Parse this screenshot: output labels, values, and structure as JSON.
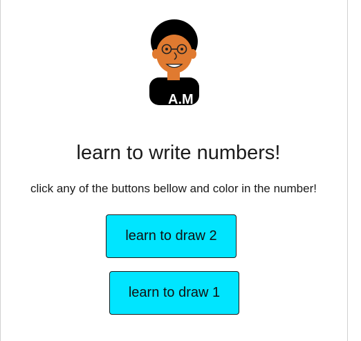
{
  "avatar": {
    "initials": "A.M",
    "skin_color": "#e07a30",
    "hair_color": "#000000"
  },
  "headline": "learn to write numbers!",
  "instructions": "click any of the buttons bellow and color in the number!",
  "buttons": [
    {
      "label": "learn to draw 2"
    },
    {
      "label": "learn to draw 1"
    }
  ],
  "colors": {
    "button_bg": "#00e5ff",
    "page_bg": "#ffffff"
  }
}
